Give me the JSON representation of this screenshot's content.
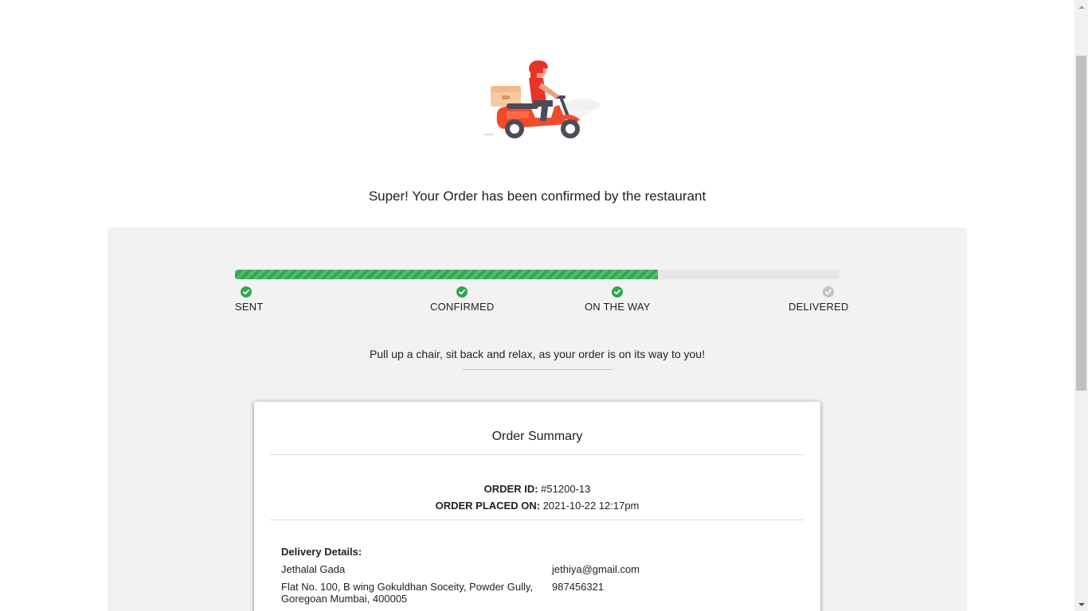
{
  "hero": {
    "headline": "Super! Your Order has been confirmed by the restaurant"
  },
  "tracker": {
    "progress_fraction": 0.7,
    "steps": [
      {
        "label": "SENT",
        "done": true
      },
      {
        "label": "CONFIRMED",
        "done": true
      },
      {
        "label": "ON THE WAY",
        "done": true
      },
      {
        "label": "DELIVERED",
        "done": false
      }
    ],
    "message": "Pull up a chair, sit back and relax, as your order is on its way to you!"
  },
  "summary": {
    "title": "Order Summary",
    "order_id_label": "ORDER ID:",
    "order_id_value": "#51200-13",
    "placed_label": "ORDER PLACED ON:",
    "placed_value": "2021-10-22 12:17pm",
    "delivery": {
      "title": "Delivery Details:",
      "name": "Jethalal Gada",
      "address": "Flat No. 100, B wing Gokuldhan Soceity, Powder Gully, Goregoan Mumbai, 400005",
      "email": "jethiya@gmail.com",
      "phone": "987456321"
    }
  },
  "colors": {
    "accent_green": "#2fa84f",
    "pending_gray": "#c4c4c4",
    "panel_bg": "#f2f2f2"
  },
  "icons": {
    "hero": "delivery-scooter-icon",
    "step_done": "check-circle-icon",
    "step_pending": "check-circle-icon"
  }
}
